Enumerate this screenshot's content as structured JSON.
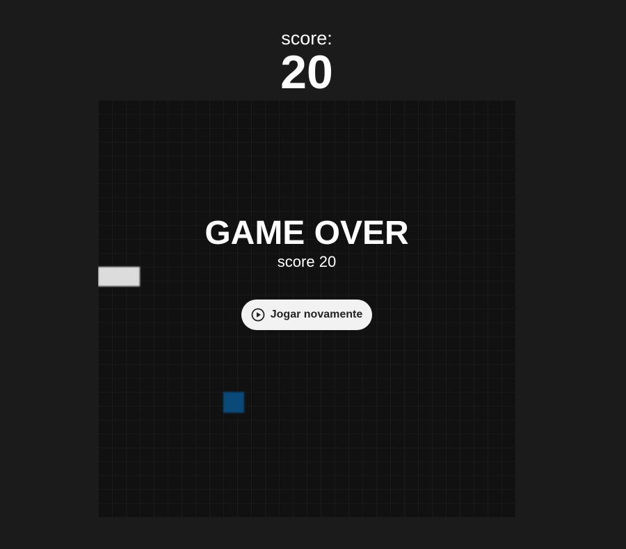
{
  "header": {
    "score_label": "score:",
    "score_value": "20"
  },
  "board": {
    "snake_color": "#dcdcdc",
    "food_color": "#0a4a78"
  },
  "game_over": {
    "title": "GAME OVER",
    "score_text": "score 20",
    "replay_button": {
      "label": "Jogar novamente",
      "icon": "play-circle-icon"
    }
  }
}
